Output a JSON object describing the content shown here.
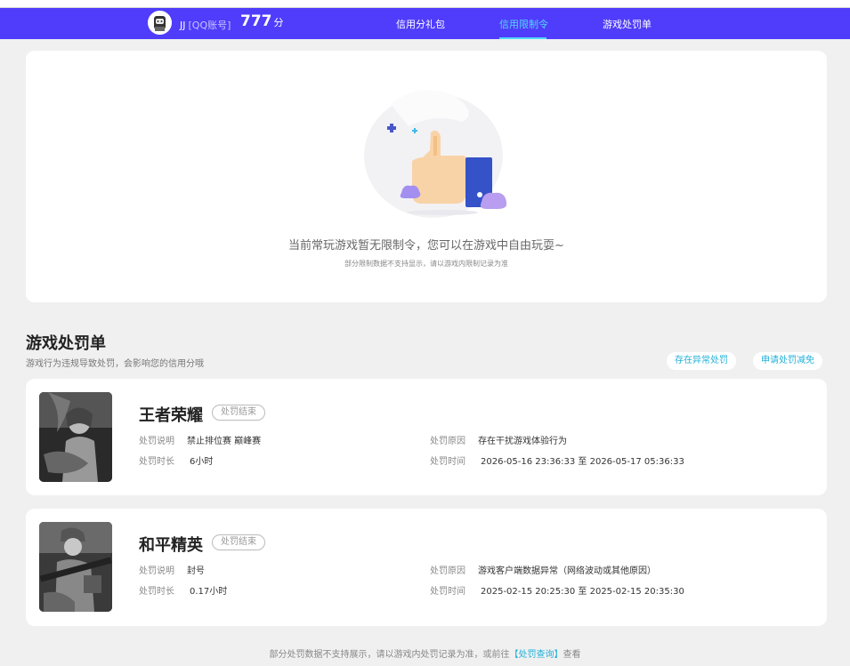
{
  "header": {
    "username": "JJ",
    "account_type": "[QQ账号]",
    "score": "777",
    "score_unit": "分",
    "tabs": [
      {
        "label": "信用分礼包",
        "active": false
      },
      {
        "label": "信用限制令",
        "active": true
      },
      {
        "label": "游戏处罚单",
        "active": false
      }
    ],
    "bg_color": "#4f3dfb",
    "active_color": "#52d7f7"
  },
  "restriction": {
    "empty_message": "当前常玩游戏暂无限制令，您可以在游戏中自由玩耍~",
    "note": "部分限制数据不支持显示，请以游戏内限制记录为准"
  },
  "penalties": {
    "title": "游戏处罚单",
    "subtitle": "游戏行为违规导致处罚，会影响您的信用分哦",
    "abnormal_button": "存在异常处罚",
    "reduce_button": "申请处罚减免",
    "labels": {
      "desc": "处罚说明",
      "duration": "处罚时长",
      "reason": "处罚原因",
      "time": "处罚时间",
      "time_sep": "至"
    },
    "items": [
      {
        "game": "王者荣耀",
        "status": "处罚结束",
        "desc": "禁止排位赛 巅峰赛",
        "duration": "6小时",
        "reason": "存在干扰游戏体验行为",
        "start": "2026-05-16 23:36:33",
        "end": "2026-05-17 05:36:33"
      },
      {
        "game": "和平精英",
        "status": "处罚结束",
        "desc": "封号",
        "duration": "0.17小时",
        "reason": "游戏客户端数据异常（网络波动或其他原因）",
        "start": "2025-02-15 20:25:30",
        "end": "2025-02-15 20:35:30"
      }
    ]
  },
  "footer": {
    "text": "部分处罚数据不支持展示，请以游戏内处罚记录为准，或前往",
    "link": "【处罚查询】",
    "suffix": "查看"
  }
}
